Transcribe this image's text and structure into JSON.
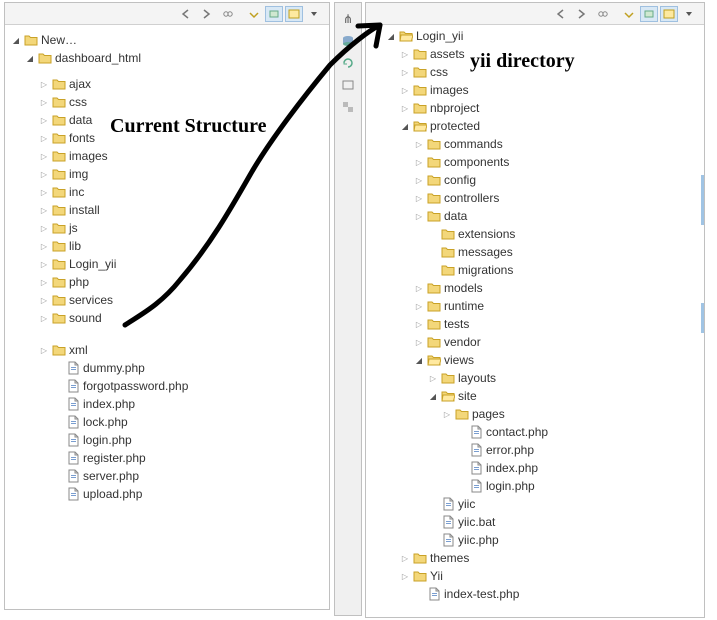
{
  "annotations": {
    "left_title": "Current Structure",
    "right_title": "yii directory"
  },
  "left": {
    "root": "New…",
    "project": "dashboard_html",
    "folders": [
      "ajax",
      "css",
      "data",
      "fonts",
      "images",
      "img",
      "inc",
      "install",
      "js",
      "lib",
      "Login_yii",
      "php",
      "services",
      "sound"
    ],
    "folders_gap": [
      "xml"
    ],
    "files": [
      "dummy.php",
      "forgotpassword.php",
      "index.php",
      "lock.php",
      "login.php",
      "register.php",
      "server.php",
      "upload.php"
    ]
  },
  "right": {
    "root": "Login_yii",
    "level1_collapsed": [
      "assets",
      "css",
      "images",
      "nbproject"
    ],
    "protected_label": "protected",
    "protected_collapsed": [
      "commands",
      "components",
      "config",
      "controllers"
    ],
    "data_label": "data",
    "data_children": [
      "extensions",
      "messages",
      "migrations"
    ],
    "protected_after_data": [
      "models",
      "runtime",
      "tests",
      "vendor"
    ],
    "views_label": "views",
    "views_layouts": "layouts",
    "site_label": "site",
    "pages_label": "pages",
    "site_files": [
      "contact.php",
      "error.php",
      "index.php",
      "login.php"
    ],
    "yiic_files": [
      "yiic",
      "yiic.bat",
      "yiic.php"
    ],
    "level1_after": [
      "themes",
      "Yii"
    ],
    "cutoff_file": "index-test.php"
  }
}
